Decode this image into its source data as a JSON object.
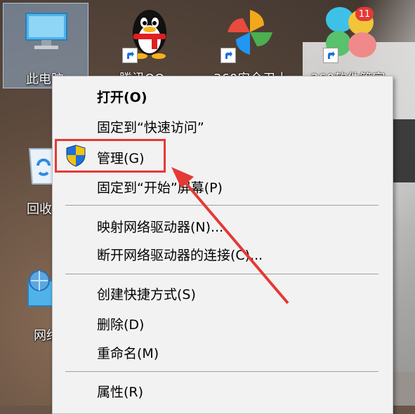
{
  "desktop": {
    "icons": [
      {
        "label": "此电脑",
        "icon": "computer-icon"
      },
      {
        "label": "腾讯QQ",
        "icon": "qq-penguin-icon"
      },
      {
        "label": "360安全卫士",
        "icon": "pinwheel-icon"
      },
      {
        "label": "360软件管家",
        "icon": "flower-app-icon",
        "badge": "11"
      },
      {
        "label": "回收站",
        "icon": "recycle-bin-icon"
      },
      {
        "label": "网络",
        "icon": "network-icon"
      }
    ]
  },
  "context_menu": {
    "open": "打开(O)",
    "pin_quick_access": "固定到“快速访问”",
    "manage": "管理(G)",
    "pin_start": "固定到“开始”屏幕(P)",
    "map_drive": "映射网络驱动器(N)...",
    "disconnect_drive": "断开网络驱动器的连接(C)...",
    "create_shortcut": "创建快捷方式(S)",
    "delete": "删除(D)",
    "rename": "重命名(M)",
    "properties": "属性(R)"
  },
  "colors": {
    "highlight": "#e53935",
    "menu_background": "#f2f2f2",
    "shield_blue": "#1e6fd9",
    "shield_yellow": "#f4c20d"
  }
}
